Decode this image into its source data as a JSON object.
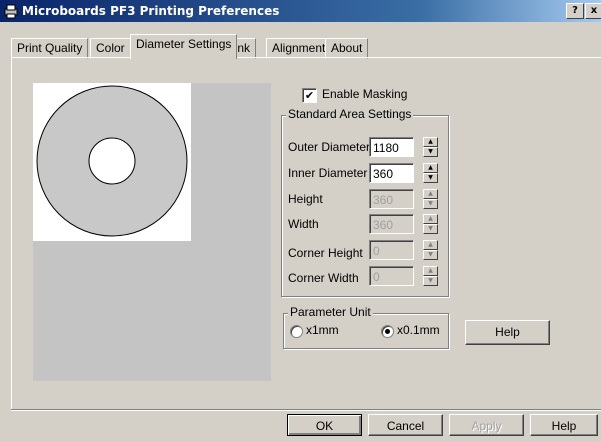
{
  "window": {
    "title": "Microboards PF3 Printing Preferences",
    "help_button": "?",
    "close_button": "x"
  },
  "tabs": [
    {
      "label": "Print Quality",
      "active": false
    },
    {
      "label": "Color",
      "active": false
    },
    {
      "label": "Diameter Settings",
      "active": true
    },
    {
      "label": "Ink",
      "active": false
    },
    {
      "label": "Alignment",
      "active": false
    },
    {
      "label": "About",
      "active": false
    }
  ],
  "masking": {
    "label": "Enable Masking",
    "checked": true,
    "check_glyph": "✔"
  },
  "standard_area": {
    "title": "Standard Area Settings",
    "fields": [
      {
        "label": "Outer Diameter",
        "value": "1180",
        "enabled": true
      },
      {
        "label": "Inner Diameter",
        "value": "360",
        "enabled": true
      },
      {
        "label": "Height",
        "value": "360",
        "enabled": false
      },
      {
        "label": "Width",
        "value": "360",
        "enabled": false
      },
      {
        "label": "Corner Height",
        "value": "0",
        "enabled": false
      },
      {
        "label": "Corner Width",
        "value": "0",
        "enabled": false
      }
    ]
  },
  "parameter_unit": {
    "title": "Parameter Unit",
    "options": [
      {
        "label": "x1mm",
        "selected": false
      },
      {
        "label": "x0.1mm",
        "selected": true
      }
    ]
  },
  "help_inline_button": "Help",
  "footer_buttons": {
    "ok": "OK",
    "cancel": "Cancel",
    "apply": "Apply",
    "help": "Help"
  },
  "colors": {
    "disc_fill": "#c8c8c8",
    "preview_bg": "#c4c4c4",
    "titlebar_start": "#0a246a",
    "titlebar_end": "#a6caf0"
  }
}
